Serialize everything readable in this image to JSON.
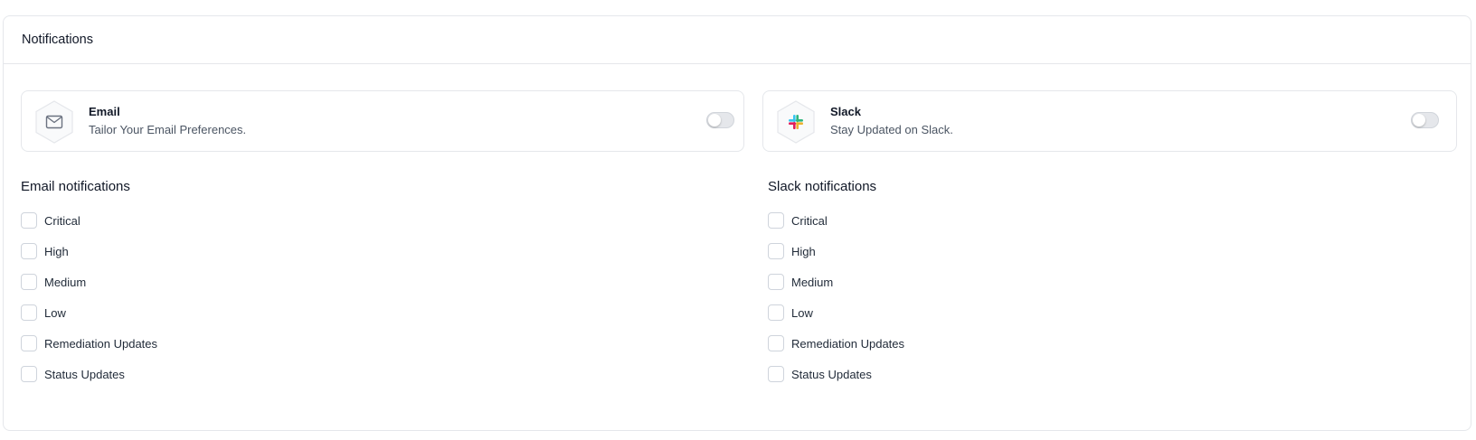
{
  "panel": {
    "title": "Notifications"
  },
  "channels": {
    "email": {
      "title": "Email",
      "subtitle": "Tailor Your Email Preferences.",
      "enabled": false,
      "icon": "mail-icon"
    },
    "slack": {
      "title": "Slack",
      "subtitle": "Stay Updated on Slack.",
      "enabled": false,
      "icon": "slack-logo-icon",
      "brand_colors": [
        "#36C5F0",
        "#2EB67D",
        "#ECB22E",
        "#E01E5A"
      ]
    }
  },
  "email_notifications": {
    "title": "Email notifications",
    "options": [
      {
        "label": "Critical",
        "checked": false
      },
      {
        "label": "High",
        "checked": false
      },
      {
        "label": "Medium",
        "checked": false
      },
      {
        "label": "Low",
        "checked": false
      },
      {
        "label": "Remediation Updates",
        "checked": false
      },
      {
        "label": "Status Updates",
        "checked": false
      }
    ]
  },
  "slack_notifications": {
    "title": "Slack notifications",
    "options": [
      {
        "label": "Critical",
        "checked": false
      },
      {
        "label": "High",
        "checked": false
      },
      {
        "label": "Medium",
        "checked": false
      },
      {
        "label": "Low",
        "checked": false
      },
      {
        "label": "Remediation Updates",
        "checked": false
      },
      {
        "label": "Status Updates",
        "checked": false
      }
    ]
  }
}
